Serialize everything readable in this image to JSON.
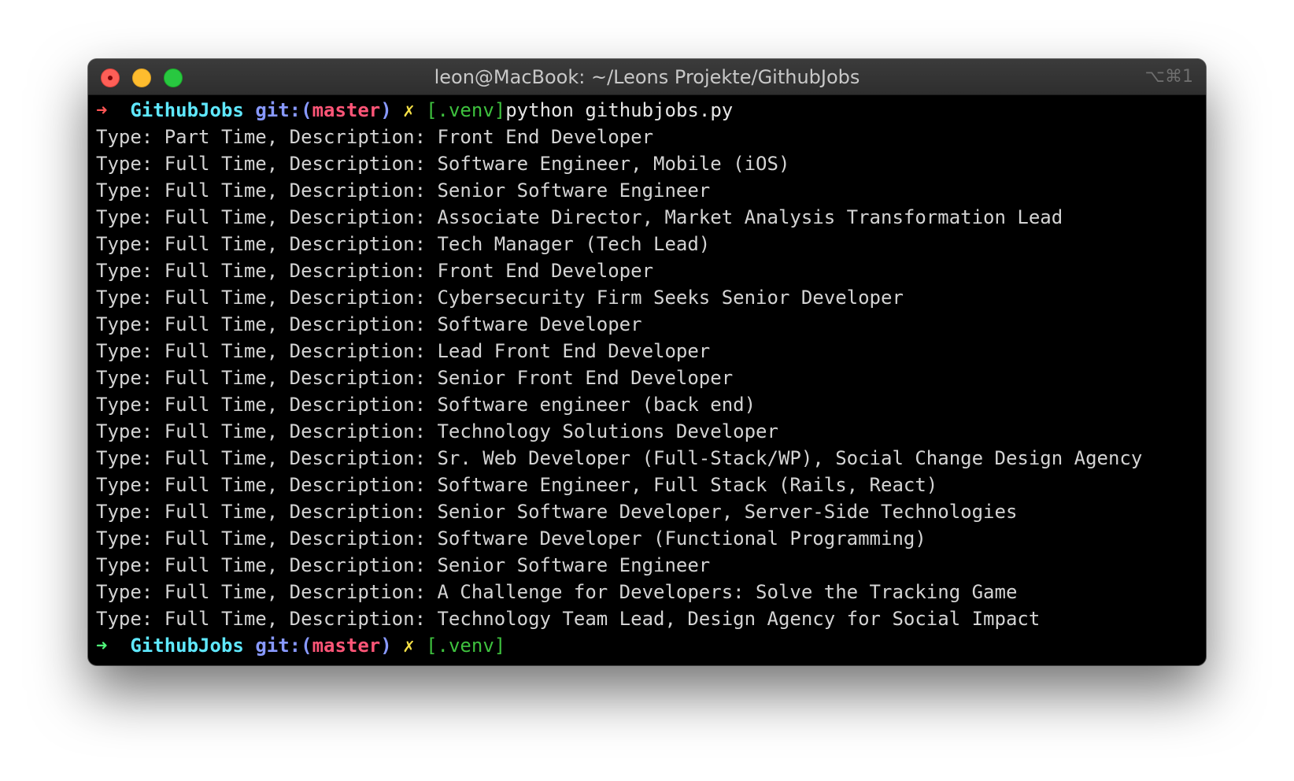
{
  "window": {
    "title": "leon@MacBook: ~/Leons Projekte/GithubJobs",
    "shortcut": "⌥⌘1"
  },
  "prompt": {
    "arrow": "➜",
    "directory": "GithubJobs",
    "git_prefix": "git:(",
    "branch": "master",
    "git_suffix": ")",
    "dirty_mark": "✗",
    "venv": "[.venv]",
    "command": "python githubjobs.py"
  },
  "output": [
    "Type: Part Time, Description: Front End Developer",
    "Type: Full Time, Description: Software Engineer, Mobile (iOS)",
    "Type: Full Time, Description: Senior Software Engineer",
    "Type: Full Time, Description: Associate Director, Market Analysis Transformation Lead",
    "Type: Full Time, Description: Tech Manager (Tech Lead)",
    "Type: Full Time, Description: Front End Developer",
    "Type: Full Time, Description: Cybersecurity Firm Seeks Senior Developer",
    "Type: Full Time, Description: Software Developer",
    "Type: Full Time, Description: Lead Front End Developer",
    "Type: Full Time, Description: Senior Front End Developer",
    "Type: Full Time, Description: Software engineer (back end)",
    "Type: Full Time, Description: Technology Solutions Developer",
    "Type: Full Time, Description: Sr. Web Developer (Full-Stack/WP), Social Change Design Agency",
    "Type: Full Time, Description: Software Engineer, Full Stack (Rails, React)",
    "Type: Full Time, Description: Senior Software Developer, Server-Side Technologies",
    "Type: Full Time, Description: Software Developer (Functional Programming)",
    "Type: Full Time, Description: Senior Software Engineer",
    "Type: Full Time, Description: A Challenge for Developers: Solve the Tracking Game",
    "Type: Full Time, Description: Technology Team Lead, Design Agency for Social Impact"
  ],
  "colors": {
    "prompt_arrow_first": "#ff5555",
    "prompt_arrow_last": "#50fa7b",
    "directory": "#5fe8ff",
    "git": "#8899ff",
    "branch": "#ff5577",
    "dirty": "#f5e046",
    "venv": "#3ec13e"
  }
}
